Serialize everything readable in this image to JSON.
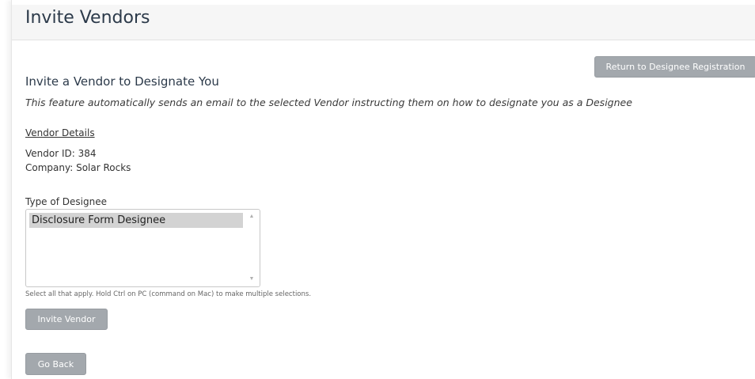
{
  "header": {
    "title": "Invite Vendors"
  },
  "actions": {
    "return_label": "Return to Designee Registration"
  },
  "main": {
    "subtitle": "Invite a Vendor to Designate You",
    "description": "This feature automatically sends an email to the selected Vendor instructing them on how to designate you as a Designee",
    "vendor_details_label": "Vendor Details",
    "vendor_id_line": "Vendor ID: 384",
    "company_line": "Company: Solar Rocks",
    "type_label": "Type of Designee",
    "designee_options": [
      {
        "label": "Disclosure Form Designee",
        "selected": true
      }
    ],
    "help_text": "Select all that apply. Hold Ctrl on PC (command on Mac) to make multiple selections.",
    "invite_label": "Invite Vendor",
    "back_label": "Go Back"
  },
  "colors": {
    "button_bg": "#a3a8ad",
    "selected_option_bg": "#d3d3d3",
    "header_bg": "#f6f6f6"
  }
}
